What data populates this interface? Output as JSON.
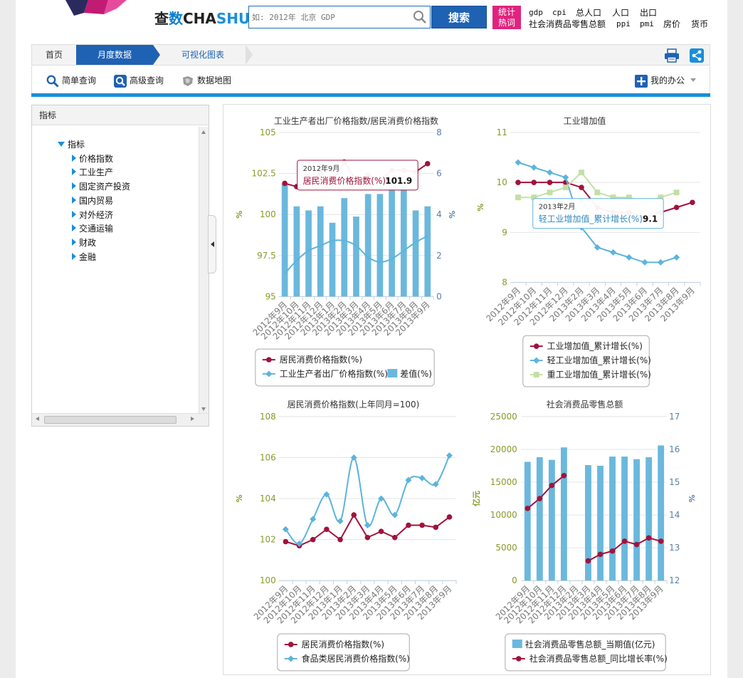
{
  "header": {
    "brand_cn_1": "查",
    "brand_cn_2": "数",
    "brand_en_1": "CHA",
    "brand_en_2": "SHU",
    "search_placeholder": "如: 2012年 北京 GDP",
    "search_button": "搜索",
    "hot_badge_line1": "统计",
    "hot_badge_line2": "热词",
    "hotwords_row1": [
      "gdp",
      "cpi",
      "总人口",
      "人口",
      "出口"
    ],
    "hotwords_row2": [
      "社会消费品零售总额",
      "ppi",
      "pmi",
      "房价",
      "货币"
    ]
  },
  "breadcrumb": {
    "home": "首页",
    "current": "月度数据",
    "visual": "可视化图表"
  },
  "toolbar": {
    "simple_query": "简单查询",
    "advanced_query": "高级查询",
    "data_map": "数据地图",
    "my_office": "我的办公"
  },
  "tree": {
    "header": "指标",
    "root": "指标",
    "items": [
      "价格指数",
      "工业生产",
      "固定资产投资",
      "国内贸易",
      "对外经济",
      "交通运输",
      "财政",
      "金融"
    ]
  },
  "colors": {
    "crimson": "#a0133c",
    "sky": "#5cb4dc",
    "bar": "#6bb8dd",
    "light_green": "#c4dfa5",
    "axis_green": "#8a9a2a",
    "axis_blue": "#5a7fa8",
    "brand_blue": "#1f62b3"
  },
  "chart_data": [
    {
      "type": "bar+line",
      "title": "工业生产者出厂价格指数/居民消费价格指数",
      "categories": [
        "2012年9月",
        "2012年10月",
        "2012年11月",
        "2012年12月",
        "2013年1月",
        "2013年2月",
        "2013年3月",
        "2013年4月",
        "2013年5月",
        "2013年6月",
        "2013年7月",
        "2013年8月",
        "2013年9月"
      ],
      "ylabel_left": "%",
      "ylabel_right": "%",
      "ylim_left": [
        95,
        105
      ],
      "ylim_right": [
        0,
        8
      ],
      "yticks_left": [
        "95",
        "97.5",
        "100",
        "102.5",
        "105"
      ],
      "yticks_right": [
        "0",
        "2",
        "4",
        "6",
        "8"
      ],
      "series": [
        {
          "name": "居民消费价格指数(%)",
          "type": "line",
          "axis": "left",
          "values": [
            101.9,
            101.7,
            102.0,
            102.5,
            102.0,
            103.2,
            102.1,
            102.4,
            102.1,
            102.7,
            102.7,
            102.6,
            103.1
          ]
        },
        {
          "name": "工业生产者出厂价格指数(%)",
          "type": "line",
          "axis": "left",
          "smooth": true,
          "values": [
            96.4,
            97.2,
            97.8,
            98.1,
            98.4,
            98.4,
            98.1,
            97.4,
            97.1,
            97.3,
            97.8,
            98.3,
            98.7
          ]
        },
        {
          "name": "差值(%)",
          "type": "bar",
          "axis": "right",
          "values": [
            5.5,
            4.4,
            4.2,
            4.4,
            3.6,
            4.8,
            3.9,
            5.0,
            5.0,
            5.4,
            5.4,
            4.2,
            4.4
          ]
        }
      ],
      "tooltip": {
        "title": "2012年9月",
        "label": "居民消费价格指数(%)",
        "value": "101.9"
      }
    },
    {
      "type": "line",
      "title": "工业增加值",
      "categories": [
        "2012年9月",
        "2012年10月",
        "2012年11月",
        "2012年12月",
        "2013年2月",
        "2013年3月",
        "2013年4月",
        "2013年5月",
        "2013年6月",
        "2013年7月",
        "2013年8月",
        "2013年9月"
      ],
      "ylabel": "%",
      "ylim": [
        8,
        11
      ],
      "yticks": [
        "8",
        "9",
        "10",
        "11"
      ],
      "series": [
        {
          "name": "工业增加值_累计增长(%)",
          "values": [
            10.0,
            10.0,
            10.0,
            10.0,
            9.9,
            9.5,
            9.4,
            9.4,
            9.3,
            9.4,
            9.5,
            9.6
          ]
        },
        {
          "name": "轻工业增加值_累计增长(%)",
          "values": [
            10.4,
            10.3,
            10.2,
            10.1,
            9.1,
            8.7,
            8.6,
            8.5,
            8.4,
            8.4,
            8.5,
            null
          ]
        },
        {
          "name": "重工业增加值_累计增长(%)",
          "values": [
            9.7,
            9.7,
            9.8,
            9.9,
            10.2,
            9.8,
            9.7,
            9.7,
            9.6,
            9.7,
            9.8,
            null
          ]
        }
      ],
      "tooltip": {
        "title": "2013年2月",
        "label": "轻工业增加值_累计增长(%)",
        "value": "9.1"
      }
    },
    {
      "type": "line",
      "title": "居民消费价格指数(上年同月=100)",
      "categories": [
        "2012年9月",
        "2012年10月",
        "2012年11月",
        "2012年12月",
        "2013年1月",
        "2013年2月",
        "2013年3月",
        "2013年4月",
        "2013年5月",
        "2013年6月",
        "2013年7月",
        "2013年8月",
        "2013年9月"
      ],
      "ylabel": "%",
      "ylim": [
        100,
        108
      ],
      "yticks": [
        "100",
        "102",
        "104",
        "106",
        "108"
      ],
      "series": [
        {
          "name": "居民消费价格指数(%)",
          "values": [
            101.9,
            101.7,
            102.0,
            102.5,
            102.0,
            103.2,
            102.1,
            102.4,
            102.1,
            102.7,
            102.7,
            102.6,
            103.1
          ]
        },
        {
          "name": "食品类居民消费价格指数(%)",
          "smooth": true,
          "values": [
            102.5,
            101.8,
            103.0,
            104.2,
            102.9,
            106.0,
            102.7,
            104.0,
            103.2,
            104.9,
            105.0,
            104.7,
            106.1
          ]
        }
      ]
    },
    {
      "type": "bar+line",
      "title": "社会消费品零售总额",
      "categories": [
        "2012年9月",
        "2012年10月",
        "2012年11月",
        "2012年12月",
        "2013年2月",
        "2013年3月",
        "2013年4月",
        "2013年5月",
        "2013年6月",
        "2013年7月",
        "2013年8月",
        "2013年9月"
      ],
      "ylabel_left": "亿元",
      "ylabel_right": "%",
      "ylim_left": [
        0,
        25000
      ],
      "ylim_right": [
        12,
        17
      ],
      "yticks_left": [
        "0",
        "5000",
        "10000",
        "15000",
        "20000",
        "25000"
      ],
      "yticks_right": [
        "12",
        "13",
        "14",
        "15",
        "16",
        "17"
      ],
      "series": [
        {
          "name": "社会消费品零售总额_当期值(亿元)",
          "type": "bar",
          "axis": "left",
          "values": [
            18100,
            18800,
            18400,
            20300,
            null,
            17600,
            17500,
            18900,
            18900,
            18500,
            18800,
            20600
          ]
        },
        {
          "name": "社会消费品零售总额_同比增长率(%)",
          "type": "line",
          "axis": "right",
          "values": [
            14.2,
            14.5,
            14.9,
            15.2,
            null,
            12.6,
            12.8,
            12.9,
            13.2,
            13.1,
            13.3,
            13.2
          ]
        }
      ]
    }
  ]
}
